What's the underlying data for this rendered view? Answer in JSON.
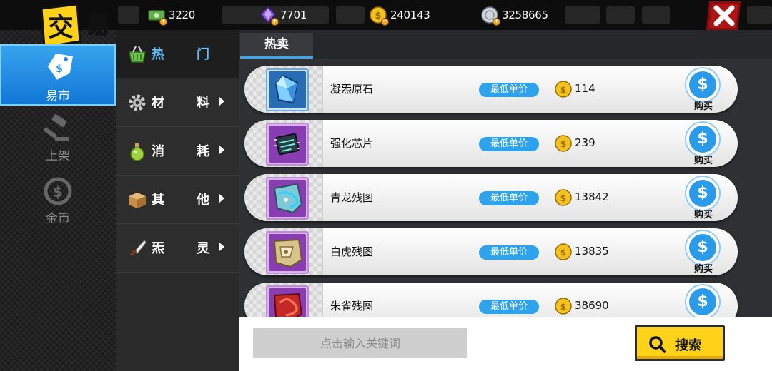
{
  "header": {
    "title_chars": [
      "交",
      "易"
    ],
    "currencies": [
      {
        "icon": "cash-icon",
        "value": "3220"
      },
      {
        "icon": "purple-crystal-icon",
        "value": "7701"
      },
      {
        "icon": "gold-coin-icon",
        "value": "240143"
      },
      {
        "icon": "silver-coin-icon",
        "value": "3258665"
      }
    ],
    "close_icon": "close-x-icon"
  },
  "left_nav": {
    "items": [
      {
        "label": "易市",
        "icon": "price-tag-icon",
        "active": true
      },
      {
        "label": "上架",
        "icon": "gavel-icon",
        "active": false
      },
      {
        "label": "金币",
        "icon": "coin-dollar-icon",
        "active": false
      }
    ]
  },
  "categories": [
    {
      "c1": "热",
      "c2": "门",
      "icon": "basket-icon",
      "active": true,
      "arrow": false
    },
    {
      "c1": "材",
      "c2": "料",
      "icon": "gear-icon",
      "active": false,
      "arrow": true
    },
    {
      "c1": "消",
      "c2": "耗",
      "icon": "potion-icon",
      "active": false,
      "arrow": true
    },
    {
      "c1": "其",
      "c2": "他",
      "icon": "box-icon",
      "active": false,
      "arrow": true
    },
    {
      "c1": "炁",
      "c2": "灵",
      "icon": "knife-icon",
      "active": false,
      "arrow": true
    }
  ],
  "tabs": [
    {
      "label": "热卖",
      "active": true
    }
  ],
  "listings": [
    {
      "name": "凝炁原石",
      "tag": "最低单价",
      "price": "114",
      "buy_label": "购买",
      "icon": "blue-crystal-icon"
    },
    {
      "name": "强化芯片",
      "tag": "最低单价",
      "price": "239",
      "buy_label": "购买",
      "icon": "chip-icon"
    },
    {
      "name": "青龙残图",
      "tag": "最低单价",
      "price": "13842",
      "buy_label": "购买",
      "icon": "azure-map-fragment-icon"
    },
    {
      "name": "白虎残图",
      "tag": "最低单价",
      "price": "13835",
      "buy_label": "购买",
      "icon": "white-tiger-map-fragment-icon"
    },
    {
      "name": "朱雀残图",
      "tag": "最低单价",
      "price": "38690",
      "buy_label": "购买",
      "icon": "vermilion-map-fragment-icon"
    }
  ],
  "search": {
    "placeholder": "点击输入关键词",
    "value": "",
    "button_label": "搜索",
    "button_icon": "magnifier-icon"
  },
  "colors": {
    "accent_blue": "#2ea2ea",
    "search_yellow": "#ffd21a",
    "item_frame_purple": "#9c4fbf",
    "close_red": "#b01515"
  }
}
